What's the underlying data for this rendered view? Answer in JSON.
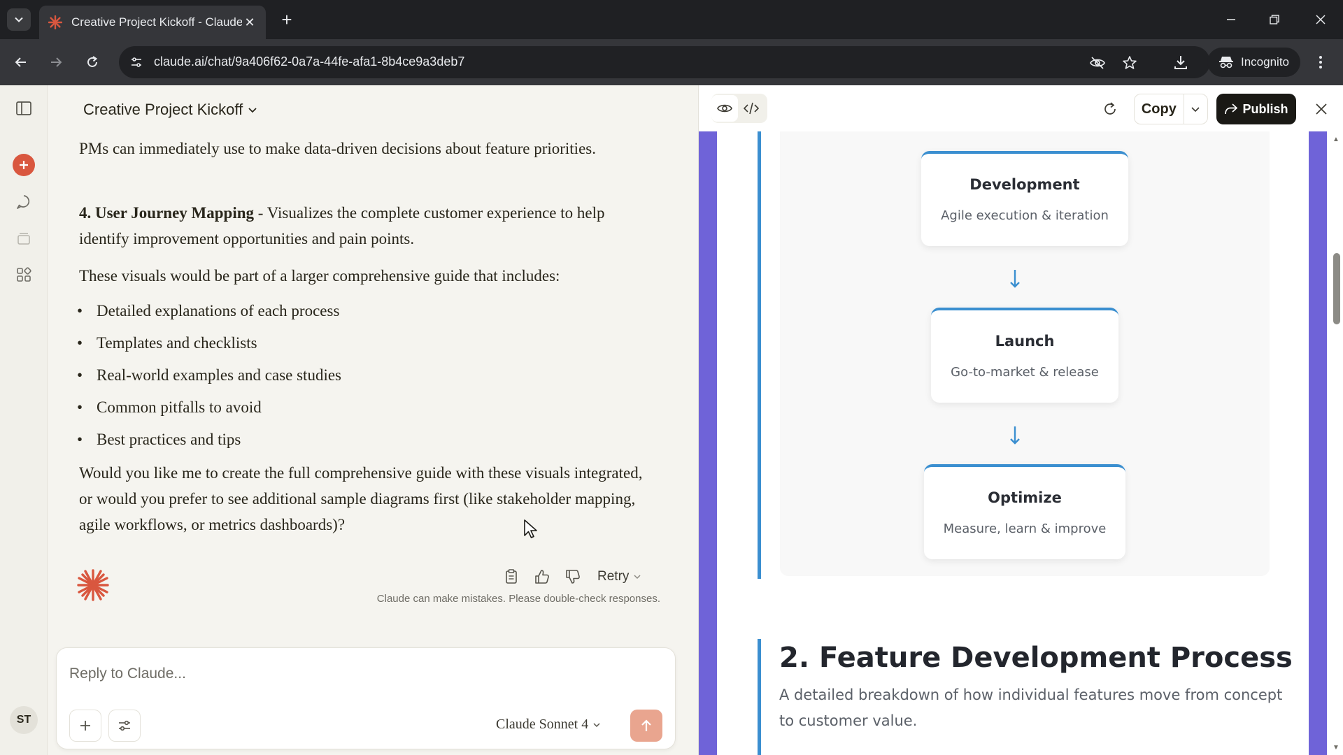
{
  "browser": {
    "tab_title": "Creative Project Kickoff - Claude",
    "url": "claude.ai/chat/9a406f62-0a7a-44fe-afa1-8b4ce9a3deb7",
    "incognito_label": "Incognito"
  },
  "chat": {
    "title": "Creative Project Kickoff",
    "paragraph_1": "PMs can immediately use to make data-driven decisions about feature priorities.",
    "item4_bold": "4. User Journey Mapping",
    "item4_text": " - Visualizes the complete customer experience to help identify improvement opportunities and pain points.",
    "paragraph_2": "These visuals would be part of a larger comprehensive guide that includes:",
    "bullets": [
      "Detailed explanations of each process",
      "Templates and checklists",
      "Real-world examples and case studies",
      "Common pitfalls to avoid",
      "Best practices and tips"
    ],
    "paragraph_3": "Would you like me to create the full comprehensive guide with these visuals integrated, or would you prefer to see additional sample diagrams first (like stakeholder mapping, agile workflows, or metrics dashboards)?",
    "retry_label": "Retry",
    "disclaimer": "Claude can make mistakes. Please double-check responses.",
    "composer_placeholder": "Reply to Claude...",
    "model_name": "Claude Sonnet 4",
    "user_initials": "ST"
  },
  "artifact": {
    "copy_label": "Copy",
    "publish_label": "Publish",
    "steps": [
      {
        "title": "Development",
        "desc": "Agile execution & iteration"
      },
      {
        "title": "Launch",
        "desc": "Go-to-market & release"
      },
      {
        "title": "Optimize",
        "desc": "Measure, learn & improve"
      }
    ],
    "section_title": "2. Feature Development Process",
    "section_desc": "A detailed breakdown of how individual features move from concept to customer value."
  },
  "colors": {
    "accent": "#d9573f",
    "flow_blue": "#3b8fd0",
    "artifact_border": "#6f63d8",
    "publish_bg": "#1a1915"
  },
  "icons": [
    "tab-list-icon",
    "claude-favicon",
    "close-icon",
    "plus-icon",
    "minimize-icon",
    "restore-icon",
    "back-icon",
    "forward-icon",
    "reload-icon",
    "site-info-icon",
    "eye-off-icon",
    "star-icon",
    "download-icon",
    "incognito-icon",
    "kebab-menu-icon",
    "sidebar-toggle-icon",
    "chat-search-icon",
    "projects-icon",
    "artifacts-icon",
    "copy-icon",
    "thumbs-up-icon",
    "thumbs-down-icon",
    "chevron-down-icon",
    "tools-icon",
    "send-arrow-icon",
    "preview-eye-icon",
    "code-icon",
    "refresh-icon",
    "publish-icon",
    "arrow-down-icon"
  ]
}
